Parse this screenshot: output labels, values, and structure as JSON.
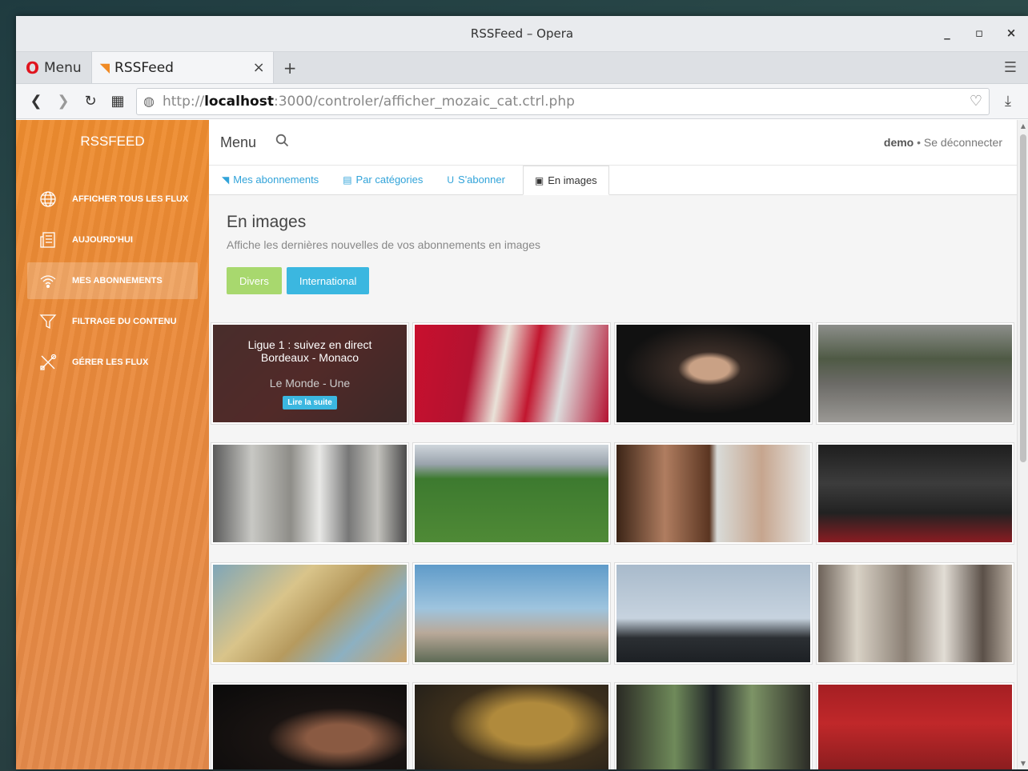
{
  "window": {
    "title": "RSSFeed – Opera",
    "controls": {
      "minimize": "_",
      "maximize": "▫",
      "close": "×"
    }
  },
  "tabbar": {
    "menu_label": "Menu",
    "tab_title": "RSSFeed",
    "tab_close": "×",
    "new_tab": "+",
    "tab_menu": "☰"
  },
  "addressbar": {
    "scheme": "http://",
    "host": "localhost",
    "rest": ":3000/controler/afficher_mozaic_cat.ctrl.php"
  },
  "sidebar": {
    "brand": "RSSFEED",
    "items": [
      {
        "label": "AFFICHER TOUS LES FLUX",
        "icon": "globe-icon"
      },
      {
        "label": "AUJOURD'HUI",
        "icon": "newspaper-icon"
      },
      {
        "label": "MES ABONNEMENTS",
        "icon": "wifi-icon",
        "active": true
      },
      {
        "label": "FILTRAGE DU CONTENU",
        "icon": "filter-icon"
      },
      {
        "label": "GÉRER LES FLUX",
        "icon": "tools-icon"
      }
    ]
  },
  "topnav": {
    "menu_label": "Menu",
    "user": "demo",
    "separator": " • ",
    "logout": "Se déconnecter"
  },
  "tabs": [
    {
      "label": "Mes abonnements",
      "icon": "rss-icon"
    },
    {
      "label": "Par catégories",
      "icon": "list-icon"
    },
    {
      "label": "S'abonner",
      "icon": "magnet-icon"
    },
    {
      "label": "En images",
      "icon": "picture-icon",
      "active": true
    }
  ],
  "content": {
    "heading": "En images",
    "subtitle": "Affiche les dernières nouvelles de vos abonnements en images",
    "filters": [
      "Divers",
      "International"
    ]
  },
  "featured": {
    "title_line1": "Ligue 1 : suivez en direct",
    "title_line2": "Bordeaux - Monaco",
    "source": "Le Monde - Une",
    "button": "Lire la suite"
  },
  "colors": {
    "sidebar_orange": "#ee8c2f",
    "accent_blue": "#3bb7e0",
    "divers_green": "#a8d86e",
    "tab_link": "#31a3d9"
  }
}
